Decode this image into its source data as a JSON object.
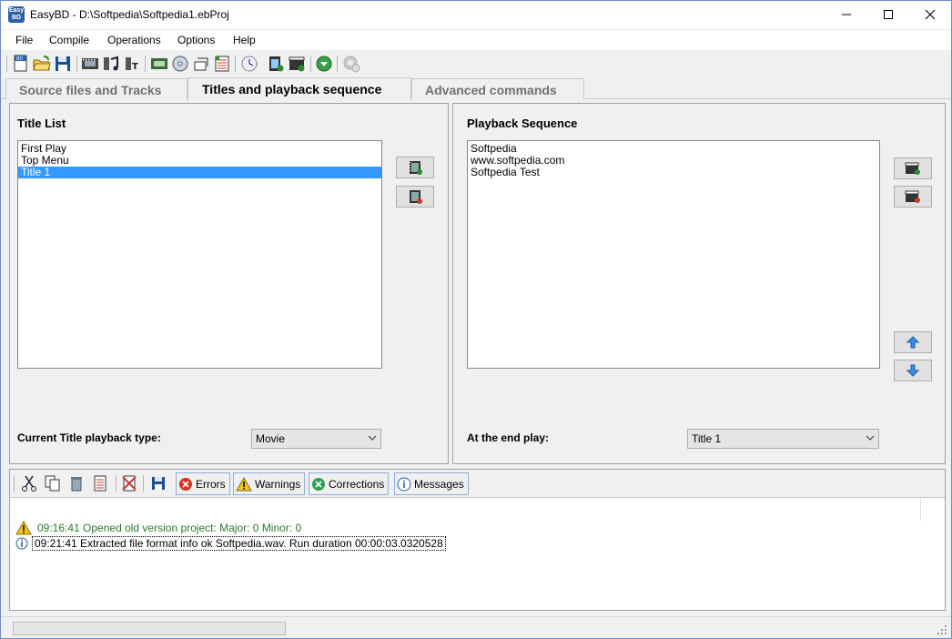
{
  "window": {
    "title": "EasyBD - D:\\Softpedia\\Softpedia1.ebProj",
    "app_icon_text": "Easy BD"
  },
  "menu": [
    "File",
    "Compile",
    "Operations",
    "Options",
    "Help"
  ],
  "tabs": [
    {
      "label": "Source files and Tracks",
      "active": false
    },
    {
      "label": "Titles and playback sequence",
      "active": true
    },
    {
      "label": "Advanced commands",
      "active": false
    }
  ],
  "title_list": {
    "heading": "Title List",
    "items": [
      "First Play",
      "Top Menu",
      "Title 1"
    ],
    "selected_index": 2,
    "playback_type_label": "Current  Title playback type:",
    "playback_type_value": "Movie"
  },
  "playback_sequence": {
    "heading": "Playback Sequence",
    "items": [
      "Softpedia",
      "www.softpedia.com",
      "Softpedia Test"
    ],
    "end_play_label": "At the end play:",
    "end_play_value": "Title 1"
  },
  "log": {
    "filters": [
      "Errors",
      "Warnings",
      "Corrections",
      "Messages"
    ],
    "entries": [
      {
        "type": "warning",
        "text": "09:16:41 Opened old version project: Major: 0 Minor: 0",
        "color": "#2a7a2a"
      },
      {
        "type": "info",
        "text": "09:21:41 Extracted file format info ok Softpedia.wav. Run duration 00:00:03.0320528",
        "color": "#000000"
      }
    ]
  },
  "colors": {
    "selection": "#3399ff",
    "accent": "#2b5fa6"
  }
}
